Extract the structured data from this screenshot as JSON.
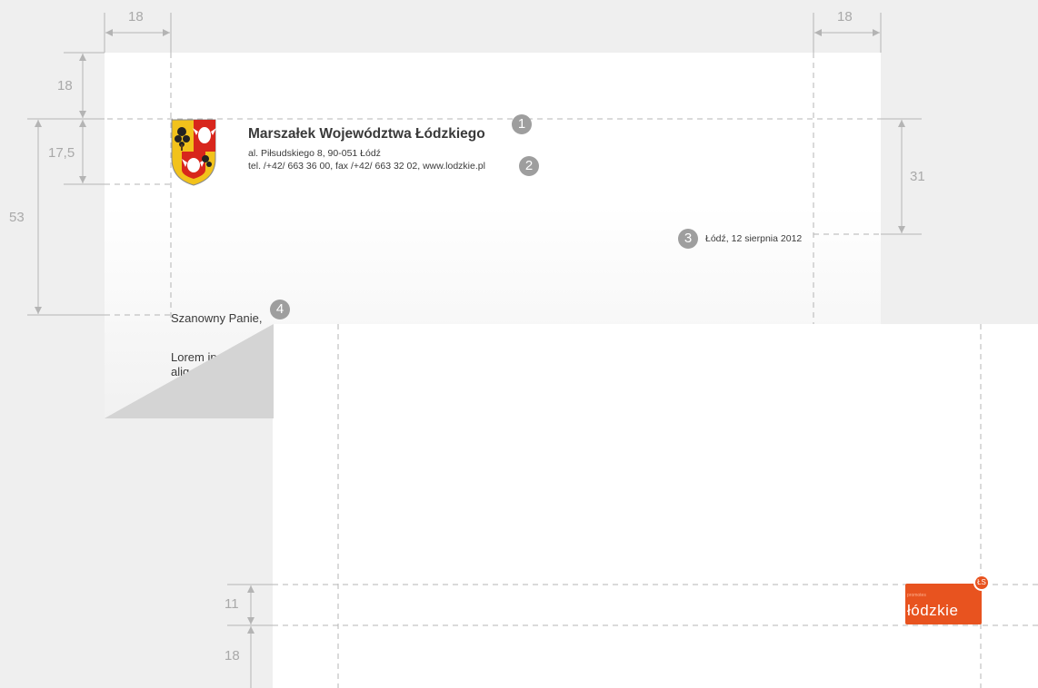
{
  "letterhead": {
    "title": "Marszałek Województwa Łódzkiego",
    "address": "al. Piłsudskiego 8, 90-051 Łódź",
    "contact": "tel. /+42/ 663 36 00, fax /+42/ 663 32 02, www.lodzkie.pl",
    "date": "Łódź, 12 sierpnia 2012"
  },
  "body": {
    "salutation": "Szanowny Panie,",
    "line1": "Lorem ip",
    "line2": "aliq"
  },
  "markers": {
    "m1": "1",
    "m2": "2",
    "m3": "3",
    "m4": "4"
  },
  "dimensions": {
    "margin_left": "18",
    "margin_right": "18",
    "margin_top": "18",
    "header_height": "17,5",
    "content_offset": "53",
    "date_offset": "31",
    "footer_logo_height": "11",
    "footer_margin": "18"
  },
  "footer_logo": {
    "wordmark": "łódzkie",
    "tagline": "promotes",
    "badge": "ŁS"
  },
  "icons": {
    "crest": "coat-of-arms-icon"
  },
  "colors": {
    "background": "#efefef",
    "page": "#ffffff",
    "guide": "#b4b4b4",
    "marker": "#9e9e9e",
    "logo": "#e8531f"
  }
}
